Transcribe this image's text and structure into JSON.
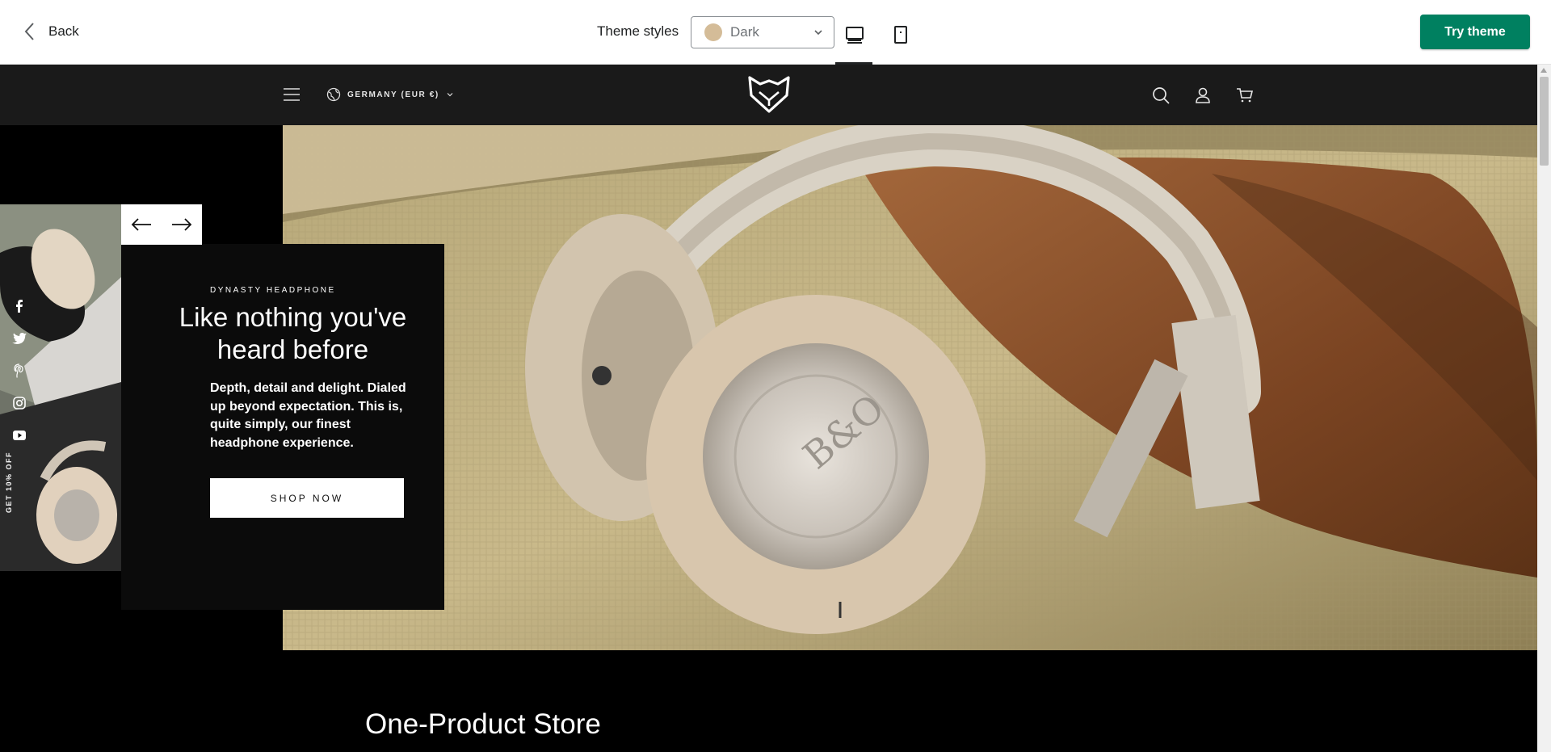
{
  "editor": {
    "back_label": "Back",
    "theme_styles_label": "Theme styles",
    "theme_select_value": "Dark",
    "theme_swatch_color": "#d4bc98",
    "try_theme_label": "Try theme",
    "accent_color": "#008060",
    "device_icons": [
      "desktop-icon",
      "mobile-icon"
    ]
  },
  "store": {
    "country_selector": "GERMANY (EUR €)",
    "nav_icons": [
      "search-icon",
      "account-icon",
      "cart-icon"
    ],
    "social_icons": [
      "facebook-icon",
      "twitter-icon",
      "pinterest-icon",
      "instagram-icon",
      "youtube-icon"
    ],
    "promo_tab": "GET 10% OFF",
    "slide": {
      "eyebrow": "DYNASTY HEADPHONE",
      "headline": "Like nothing you've heard before",
      "body": "Depth, detail and delight. Dialed up beyond expectation. This is, quite simply, our finest headphone experience.",
      "cta": "SHOP NOW"
    },
    "section_title": "One-Product Store"
  }
}
